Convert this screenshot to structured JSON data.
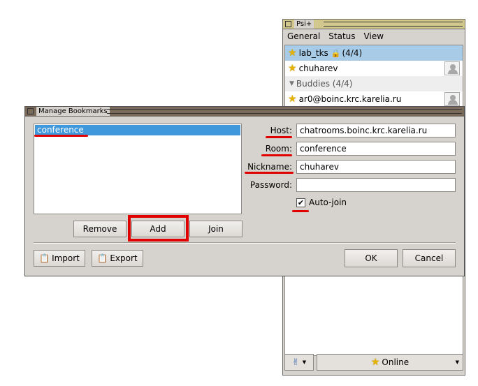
{
  "psi": {
    "title": "Psi+",
    "menu": [
      "General",
      "Status",
      "View"
    ],
    "roster": {
      "conference": {
        "name": "lab_tks",
        "count": "(4/4)"
      },
      "self": "chuharev",
      "group": "Buddies (4/4)",
      "contact": "ar0@boinc.krc.karelia.ru"
    },
    "status": "Online"
  },
  "dialog": {
    "title": "Manage Bookmarks",
    "bookmarks": [
      "conference"
    ],
    "buttons": {
      "remove": "Remove",
      "add": "Add",
      "join": "Join",
      "import": "Import",
      "export": "Export",
      "ok": "OK",
      "cancel": "Cancel"
    },
    "labels": {
      "host": "Host:",
      "room": "Room:",
      "nickname": "Nickname:",
      "password": "Password:",
      "autojoin": "Auto-join"
    },
    "values": {
      "host": "chatrooms.boinc.krc.karelia.ru",
      "room": "conference",
      "nickname": "chuharev",
      "password": ""
    },
    "autojoin_checked": "✔"
  },
  "colors": {
    "annotation": "#e00000",
    "selection": "#3f98dc"
  }
}
